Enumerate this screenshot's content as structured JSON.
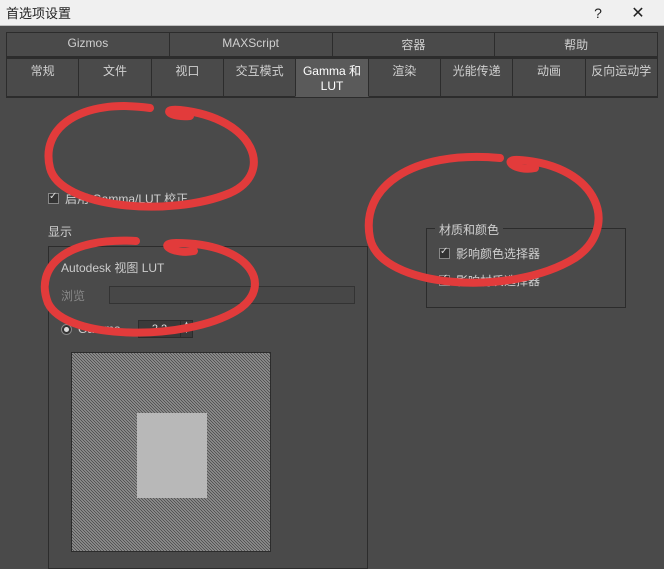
{
  "window": {
    "title": "首选项设置",
    "help_glyph": "?",
    "close_glyph": "✕"
  },
  "tabs_row1": [
    {
      "label": "Gizmos"
    },
    {
      "label": "MAXScript"
    },
    {
      "label": "容器"
    },
    {
      "label": "帮助"
    }
  ],
  "tabs_row2": [
    {
      "label": "常规"
    },
    {
      "label": "文件"
    },
    {
      "label": "视口"
    },
    {
      "label": "交互模式"
    },
    {
      "label": "Gamma 和 LUT",
      "active": true
    },
    {
      "label": "渲染"
    },
    {
      "label": "光能传递"
    },
    {
      "label": "动画"
    },
    {
      "label": "反向运动学"
    }
  ],
  "main": {
    "enable_gamma_label": "启用 Gamma/LUT 校正",
    "display_section": "显示",
    "lut_header": "Autodesk 视图 LUT",
    "lut_field_label": "浏览",
    "gamma_radio_label": "Gamma",
    "gamma_value": "2.2"
  },
  "materials": {
    "group_title": "材质和颜色",
    "affect_color_picker": "影响颜色选择器",
    "affect_material_editor": "影响材质选择器"
  }
}
